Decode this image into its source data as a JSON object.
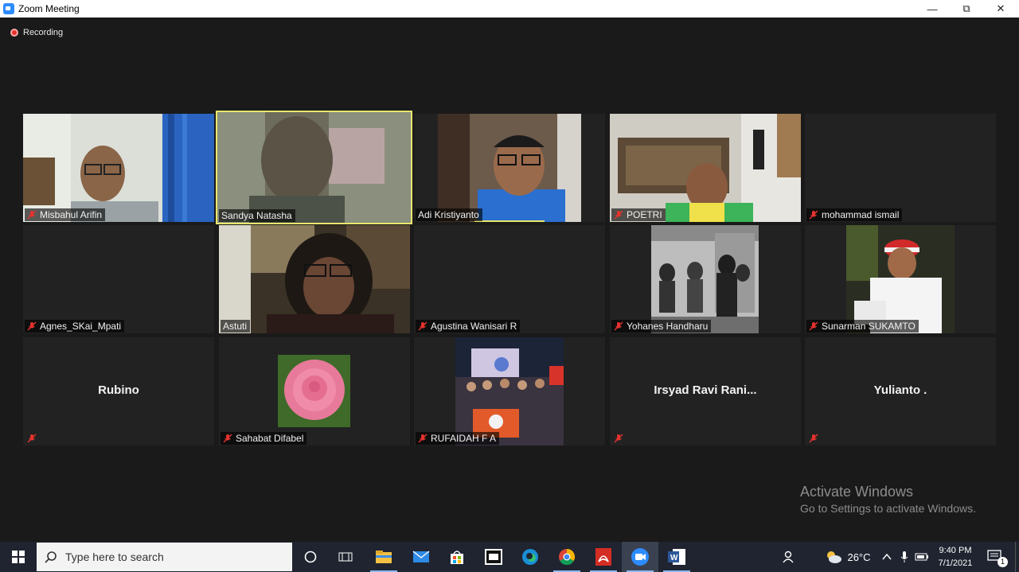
{
  "window": {
    "title": "Zoom Meeting",
    "minimize": "—",
    "maximize": "⧉",
    "close": "✕"
  },
  "recording_label": "Recording",
  "participants": [
    {
      "name": "Misbahul Arifin",
      "muted": true,
      "video": true
    },
    {
      "name": "Sandya Natasha",
      "muted": false,
      "video": true,
      "active_speaker": true
    },
    {
      "name": "Adi Kristiyanto",
      "muted": false,
      "video": true
    },
    {
      "name": "POETRI",
      "muted": true,
      "video": true
    },
    {
      "name": "mohammad ismail",
      "muted": true,
      "video": false
    },
    {
      "name": "Agnes_SKai_Mpati",
      "muted": true,
      "video": false
    },
    {
      "name": "Astuti",
      "muted": false,
      "video": true
    },
    {
      "name": "Agustina Wanisari R",
      "muted": true,
      "video": false
    },
    {
      "name": "Yohanes Handharu",
      "muted": true,
      "video": true
    },
    {
      "name": "Sunarman SUKAMTO",
      "muted": true,
      "video": true
    },
    {
      "name": "Rubino",
      "muted": true,
      "video": false
    },
    {
      "name": "Sahabat Difabel",
      "muted": true,
      "video": true
    },
    {
      "name": "RUFAIDAH F A",
      "muted": true,
      "video": true
    },
    {
      "name": "Irsyad Ravi Rani...",
      "muted": true,
      "video": false
    },
    {
      "name": "Yulianto .",
      "muted": true,
      "video": false
    }
  ],
  "watermark": {
    "line1": "Activate Windows",
    "line2": "Go to Settings to activate Windows."
  },
  "taskbar": {
    "search_placeholder": "Type here to search",
    "weather": "26°C",
    "time": "9:40 PM",
    "date": "7/1/2021",
    "notification_count": "1"
  },
  "colors": {
    "accent": "#2d8cff",
    "active_border": "#e9e66b",
    "muted_icon": "#e5322d"
  }
}
